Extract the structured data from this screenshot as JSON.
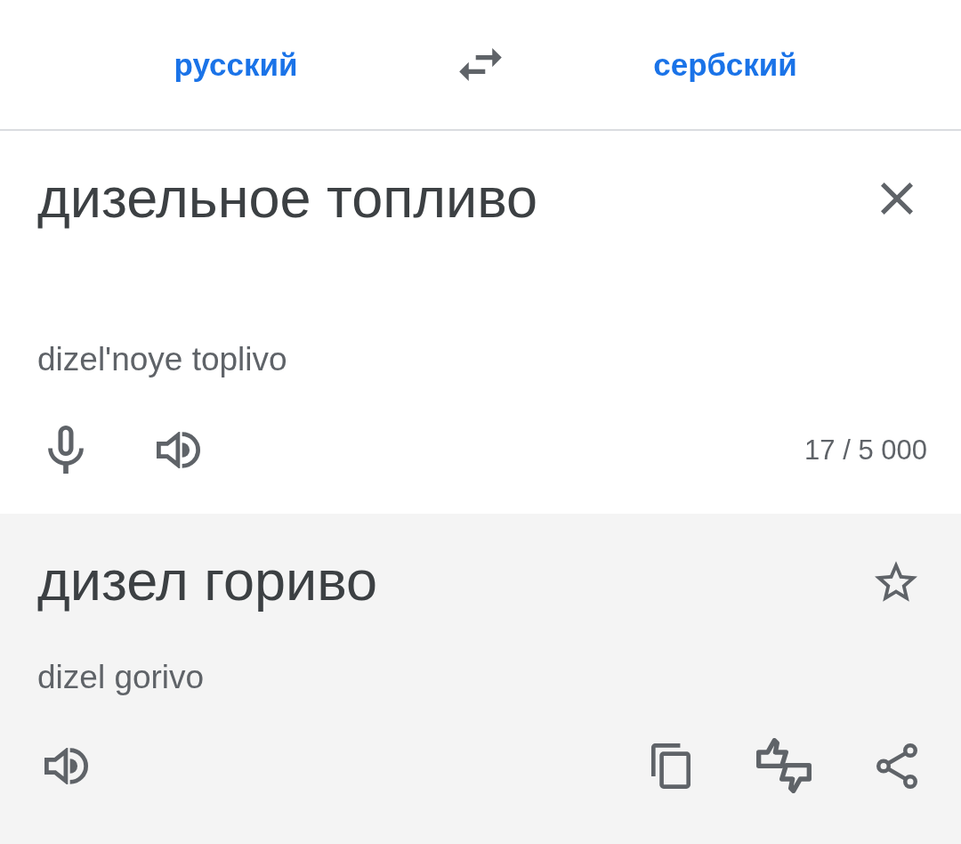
{
  "header": {
    "source_language": "русский",
    "target_language": "сербский"
  },
  "input": {
    "text": "дизельное топливо",
    "transliteration": "dizel'noye toplivo",
    "char_count": "17 / 5 000"
  },
  "output": {
    "text": "дизел гориво",
    "transliteration": "dizel gorivo",
    "starred": false
  }
}
